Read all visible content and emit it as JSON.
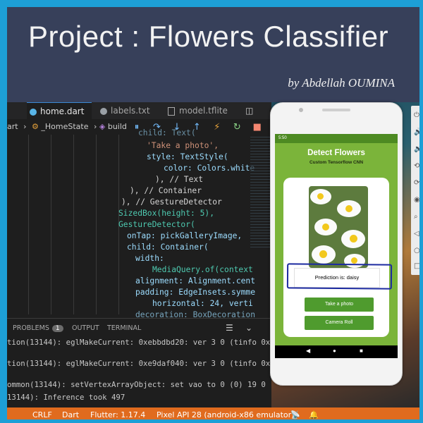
{
  "banner": {
    "title": "Project : Flowers Classifier",
    "byline": "by Abdellah  OUMINA"
  },
  "editor": {
    "tabs": [
      "home.dart",
      "labels.txt",
      "model.tflite"
    ],
    "breadcrumb": {
      "prefix": "art",
      "class": "_HomeState",
      "method": "build"
    },
    "code_lines": [
      "child: Text(",
      "'Take a photo',",
      "style: TextStyle(",
      "color: Colors.white",
      "), // Text",
      "), // Container",
      "), // GestureDetector",
      "SizedBox(height: 5),",
      "GestureDetector(",
      "onTap: pickGalleryImage,",
      "child: Container(",
      "width:",
      "MediaQuery.of(context",
      "alignment: Alignment.cent",
      "padding: EdgeInsets.symme",
      "horizontal: 24, verti",
      "decoration: BoxDecoration"
    ],
    "panel_tabs": [
      "PROBLEMS",
      "OUTPUT",
      "TERMINAL"
    ],
    "problems_count": "1",
    "terminal_lines": [
      "tion(13144): eglMakeCurrent: 0xebbdbd20: ver 3 0 (tinfo 0x",
      "tion(13144): eglMakeCurrent: 0xe9daf040: ver 3 0 (tinfo 0x",
      "ommon(13144): setVertexArrayObject: set vao to 0 (0) 19 0",
      "13144): Inference took 497"
    ],
    "status": {
      "eol": "CRLF",
      "language": "Dart",
      "flutter": "Flutter: 1.17.4",
      "device": "Pixel API 28 (android-x86 emulator)"
    }
  },
  "phone": {
    "status_time": "5:50",
    "app_title": "Detect Flowers",
    "app_subtitle": "Custom Tensorflow CNN",
    "prediction": "Prediction is: daisy",
    "buttons": [
      "Take a photo",
      "Camera Roll"
    ]
  },
  "colors": {
    "banner_bg": "#37405a",
    "border": "#1d9fd6",
    "statusbar": "#e06b1e",
    "app_green": "#7bb43a",
    "button_green": "#4f9b2e",
    "highlight_ring": "#1c2aa0"
  }
}
